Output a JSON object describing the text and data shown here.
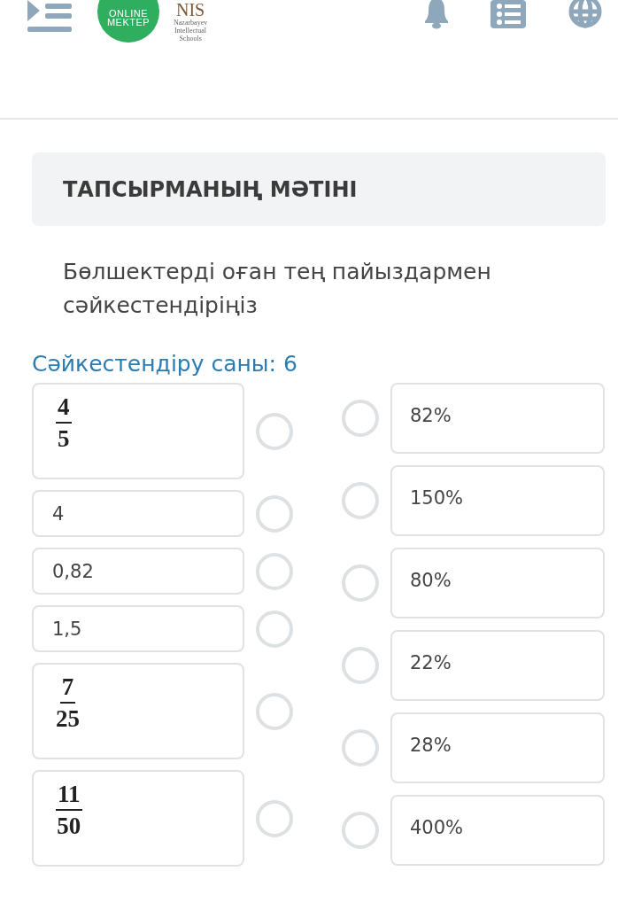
{
  "header": {
    "logo": {
      "lines": [
        "ONLINE",
        "MEKTEP"
      ]
    },
    "partner_logo": {
      "mark": "NIS",
      "lines": [
        "Nazarbayev",
        "Intellectual",
        "Schools"
      ]
    }
  },
  "task_heading": "ТАПСЫРМАНЫҢ МӘТІНІ",
  "instruction": "Бөлшектерді оған тең пайыздармен сәйкестендіріңіз",
  "match_count": "Сәйкестендіру саны: 6",
  "left_items": [
    {
      "kind": "fraction",
      "numerator": "4",
      "denominator": "5",
      "selected": false
    },
    {
      "kind": "text",
      "text": "4",
      "selected": false
    },
    {
      "kind": "text",
      "text": "0,82",
      "selected": false
    },
    {
      "kind": "text",
      "text": "1,5",
      "selected": false
    },
    {
      "kind": "fraction",
      "numerator": "7",
      "denominator": "25",
      "selected": false
    },
    {
      "kind": "fraction",
      "numerator": "11",
      "denominator": "50",
      "selected": false
    }
  ],
  "right_items": [
    {
      "text": "82%",
      "selected": false
    },
    {
      "text": "150%",
      "selected": false
    },
    {
      "text": "80%",
      "selected": false
    },
    {
      "text": "22%",
      "selected": false
    },
    {
      "text": "28%",
      "selected": false
    },
    {
      "text": "400%",
      "selected": false
    }
  ]
}
